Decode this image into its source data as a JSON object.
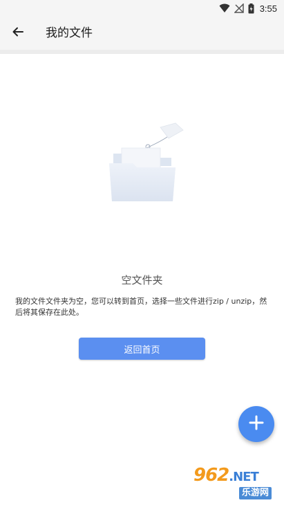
{
  "status_bar": {
    "time": "3:55",
    "icons": [
      "wifi-icon",
      "signal-off-icon",
      "battery-charging-icon"
    ]
  },
  "app_bar": {
    "back_icon": "arrow-left-icon",
    "title": "我的文件"
  },
  "empty_state": {
    "illustration": "empty-folder-icon",
    "title": "空文件夹",
    "description": "我的文件文件夹为空，您可以转到首页，选择一些文件进行zip / unzip，然后将其保存在此处。",
    "button_label": "返回首页"
  },
  "fab": {
    "icon": "plus-icon"
  },
  "watermark": {
    "logo_number": "962",
    "logo_suffix": ".NET",
    "subtitle": "乐游网"
  },
  "colors": {
    "accent": "#5b8ff0",
    "fab": "#4a8bf0",
    "app_bar_bg": "#f5f5f5"
  }
}
